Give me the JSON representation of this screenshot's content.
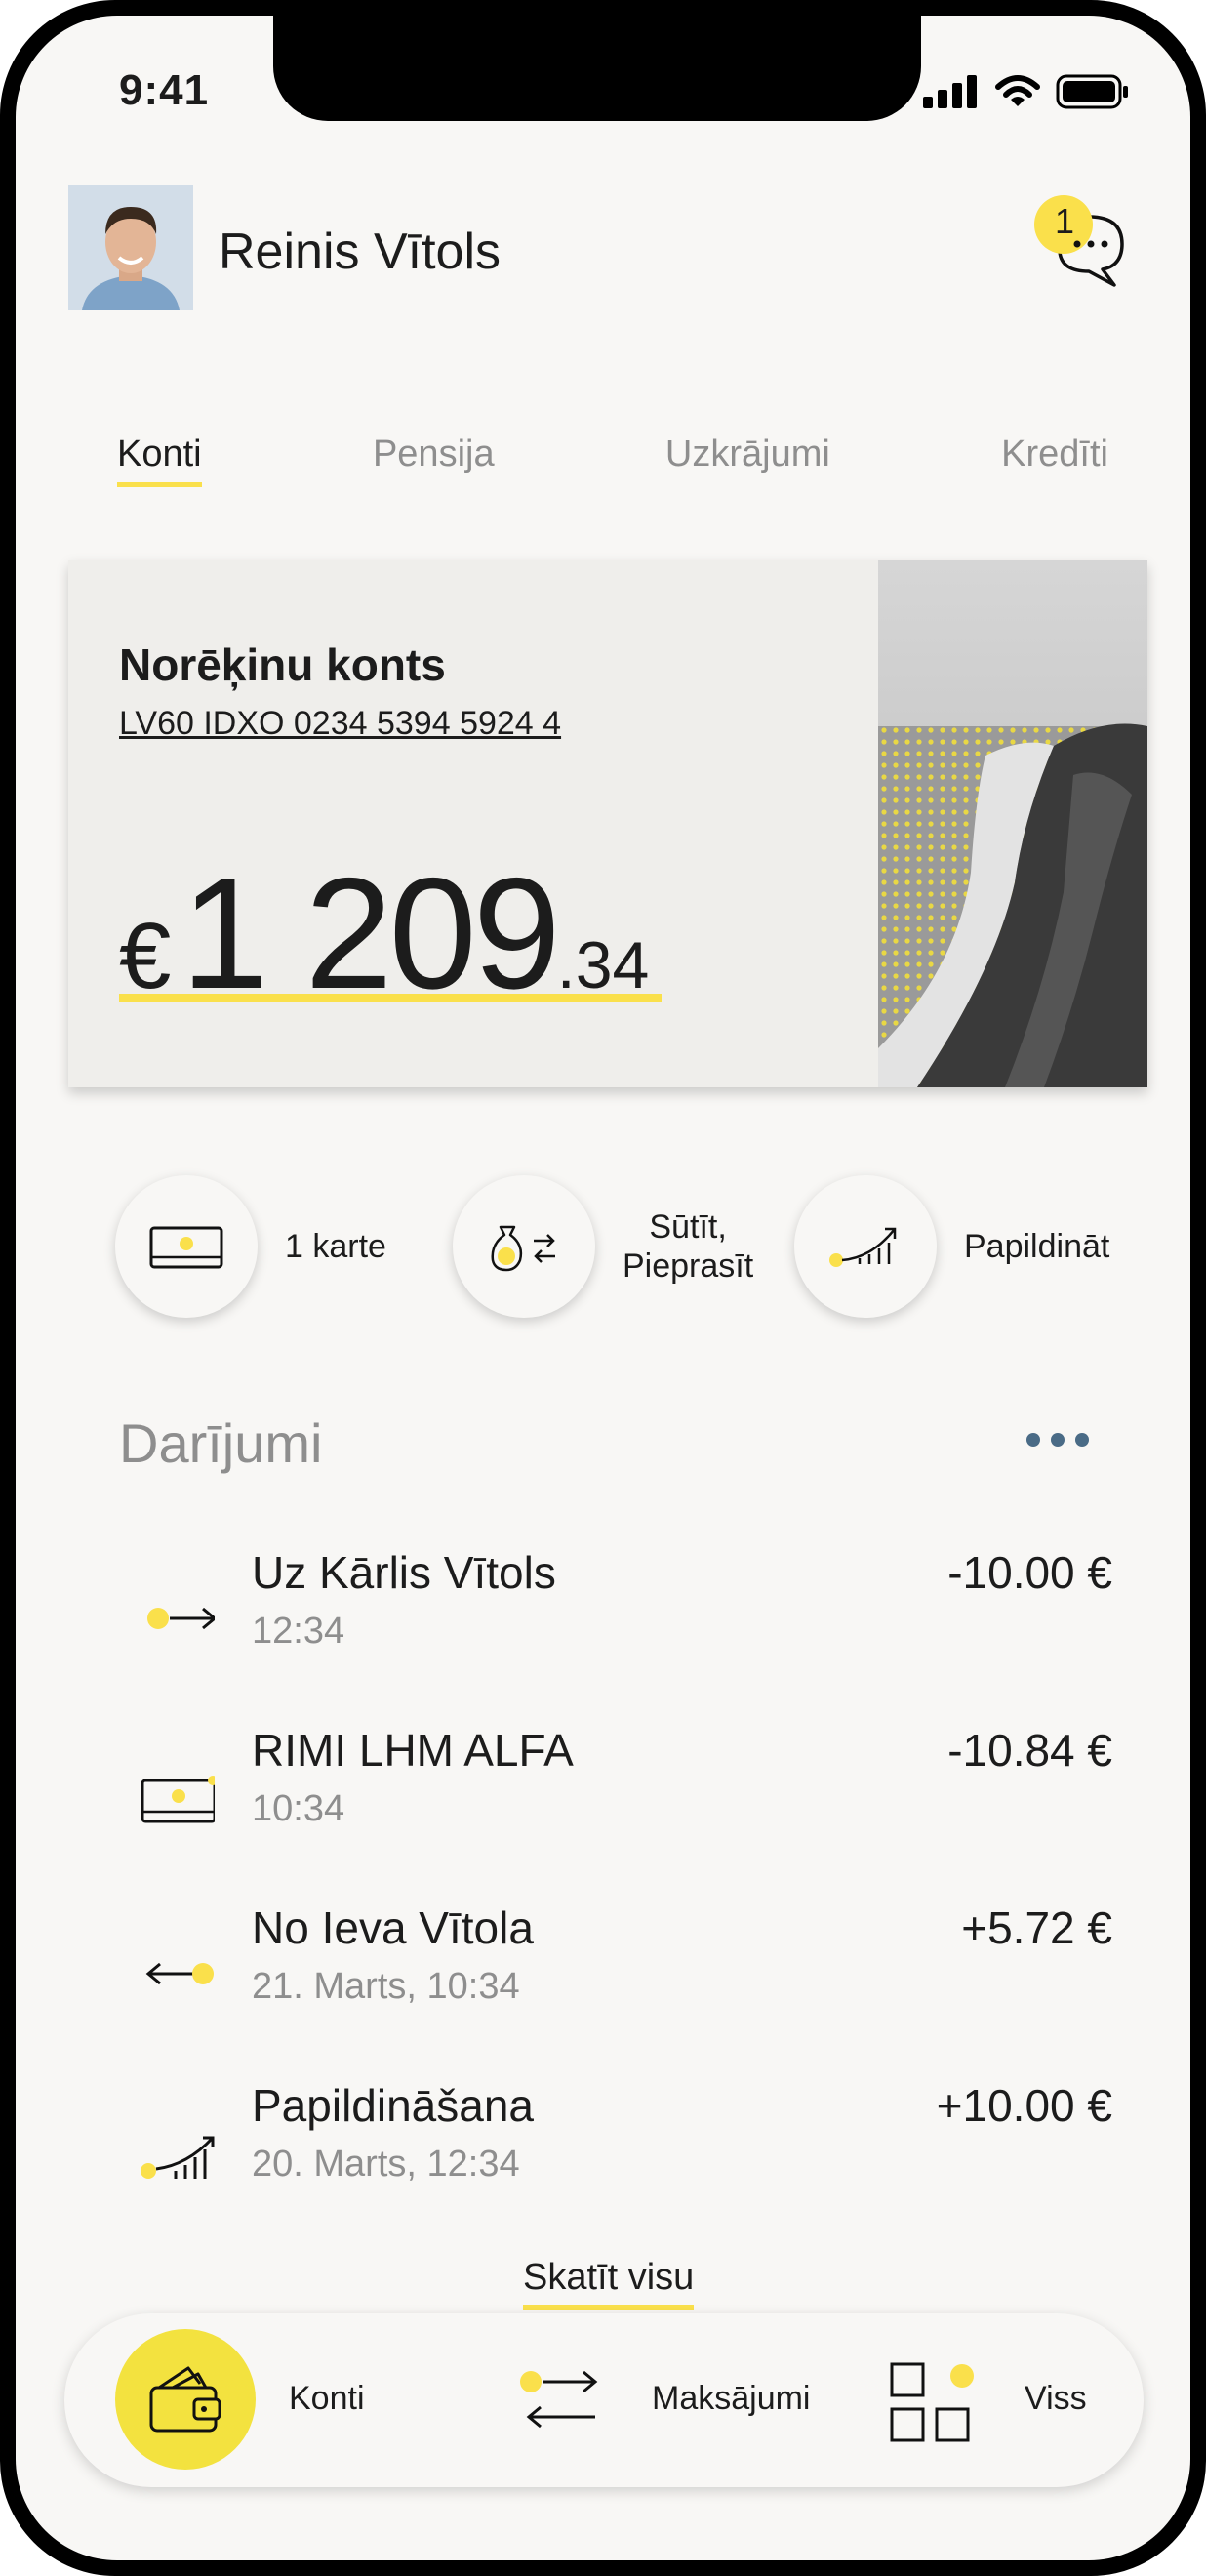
{
  "status_bar": {
    "time": "9:41"
  },
  "header": {
    "user_name": "Reinis Vītols",
    "notification_count": "1"
  },
  "tabs": [
    {
      "label": "Konti",
      "active": true
    },
    {
      "label": "Pensija",
      "active": false
    },
    {
      "label": "Uzkrājumi",
      "active": false
    },
    {
      "label": "Kredīti",
      "active": false
    }
  ],
  "account_card": {
    "title": "Norēķinu konts",
    "iban": "LV60 IDXO 0234 5394 5924 4",
    "currency": "€",
    "balance_int": "1 209",
    "balance_dec": ".34"
  },
  "actions": [
    {
      "label": "1 karte",
      "icon": "card-icon"
    },
    {
      "label_line1": "Sūtīt,",
      "label_line2": "Pieprasīt",
      "icon": "money-bag-transfer-icon"
    },
    {
      "label": "Papildināt",
      "icon": "growth-chart-icon"
    }
  ],
  "transactions_section": {
    "title": "Darījumi",
    "see_all": "Skatīt visu"
  },
  "transactions": [
    {
      "name": "Uz Kārlis Vītols",
      "time": "12:34",
      "amount": "-10.00 €",
      "icon": "outgoing-arrow-icon"
    },
    {
      "name": "RIMI LHM ALFA",
      "time": "10:34",
      "amount": "-10.84 €",
      "icon": "card-icon"
    },
    {
      "name": "No Ieva Vītola",
      "time": "21. Marts, 10:34",
      "amount": "+5.72 €",
      "icon": "incoming-arrow-icon"
    },
    {
      "name": "Papildināšana",
      "time": "20. Marts, 12:34",
      "amount": "+10.00 €",
      "icon": "growth-chart-icon"
    }
  ],
  "bottom_nav": [
    {
      "label": "Konti",
      "icon": "wallet-icon",
      "active": true
    },
    {
      "label": "Maksājumi",
      "icon": "transfer-arrows-icon",
      "active": false
    },
    {
      "label": "Viss",
      "icon": "grid-icon",
      "active": false
    }
  ],
  "colors": {
    "accent": "#fae04b",
    "background": "#f8f7f5",
    "muted_text": "#8e8e8e",
    "dots": "#4a6b86"
  }
}
